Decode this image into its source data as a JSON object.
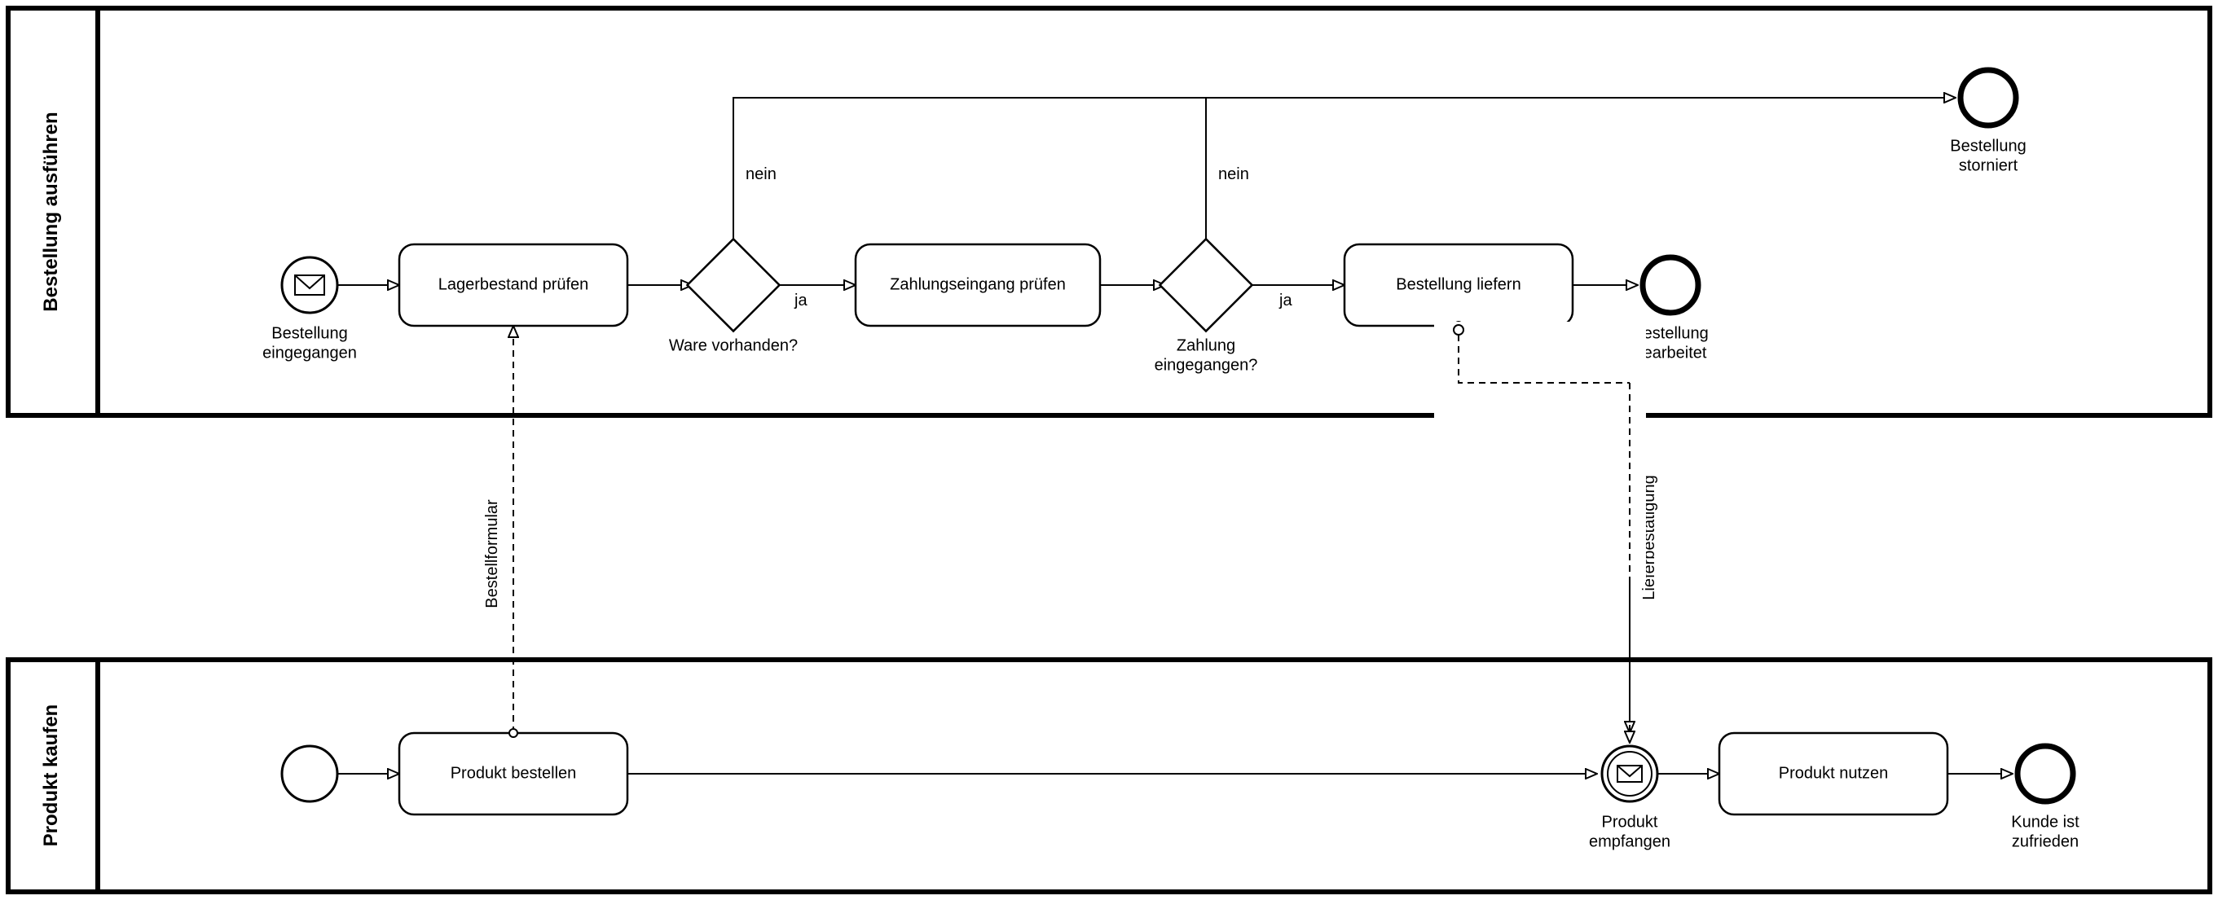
{
  "pools": {
    "top": {
      "label": "Bestellung ausführen"
    },
    "bottom": {
      "label": "Produkt kaufen"
    }
  },
  "top": {
    "start_label1": "Bestellung",
    "start_label2": "eingegangen",
    "task_stock": "Lagerbestand prüfen",
    "gw_stock_label": "Ware vorhanden?",
    "task_payment": "Zahlungseingang prüfen",
    "gw_payment_label1": "Zahlung",
    "gw_payment_label2": "eingegangen?",
    "task_deliver": "Bestellung liefern",
    "end_cancel_label1": "Bestellung",
    "end_cancel_label2": "storniert",
    "end_done_label1": "Bestellung",
    "end_done_label2": "bearbeitet",
    "yes": "ja",
    "no": "nein"
  },
  "bottom": {
    "task_order": "Produkt bestellen",
    "recv_label1": "Produkt",
    "recv_label2": "empfangen",
    "task_use": "Produkt nutzen",
    "end_label1": "Kunde ist",
    "end_label2": "zufrieden"
  },
  "messages": {
    "order_form": "Bestellformular",
    "delivery_conf": "Lieferbestätigung"
  }
}
